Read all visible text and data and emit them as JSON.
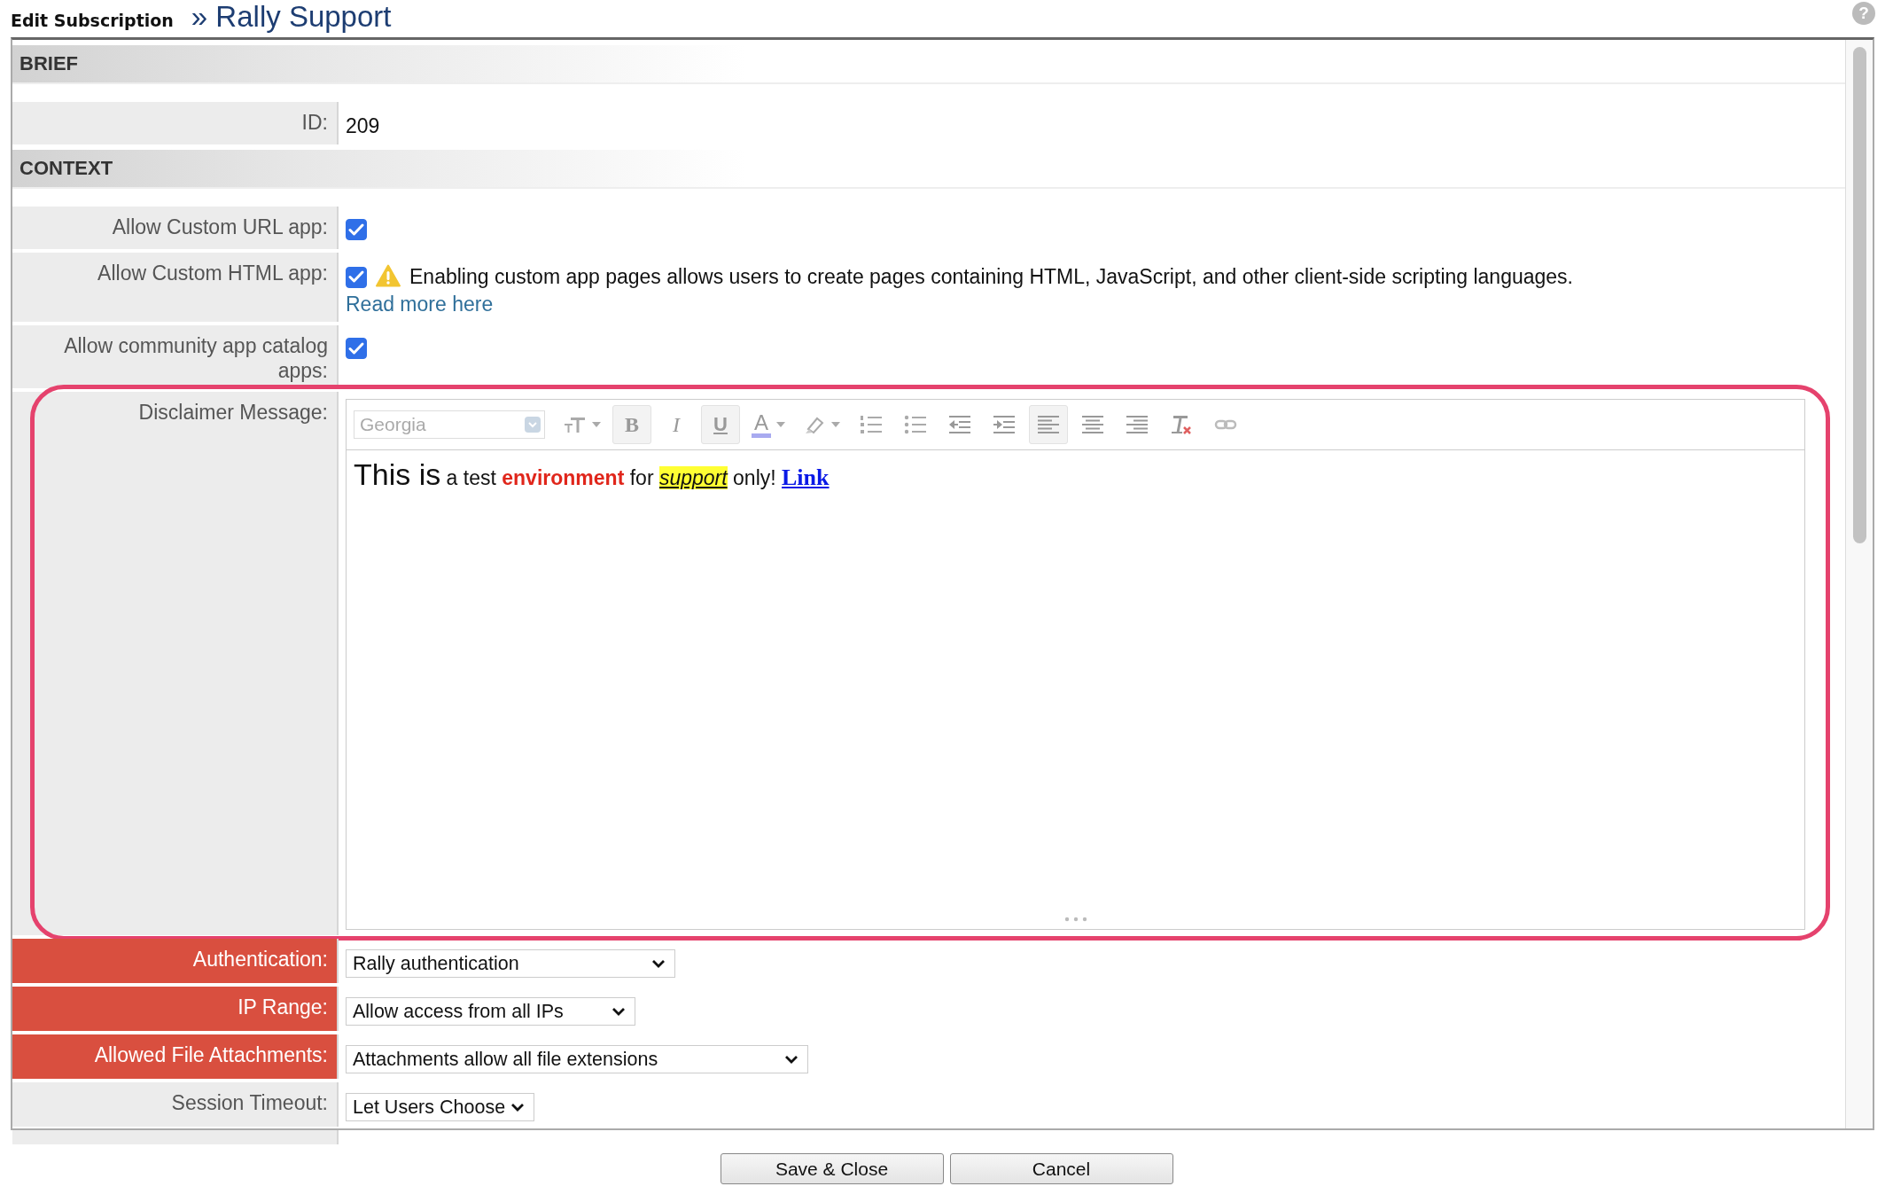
{
  "header": {
    "title": "Edit Subscription",
    "separator": "»",
    "subscription": "Rally Support",
    "help": "?"
  },
  "sections": [
    {
      "title": "BRIEF",
      "rows": [
        {
          "kind": "text",
          "label": "ID:",
          "value": "209",
          "highlighted": false
        }
      ]
    },
    {
      "title": "CONTEXT",
      "rows": [
        {
          "kind": "checkbox",
          "label": "Allow Custom URL app:",
          "checked": true,
          "highlighted": false
        },
        {
          "kind": "checkbox",
          "label": "Allow Custom HTML app:",
          "checked": true,
          "warning": "Enabling custom app pages allows users to create pages containing HTML, JavaScript, and other client-side scripting languages.",
          "link": "Read more here",
          "highlighted": false
        },
        {
          "kind": "checkbox",
          "label": "Allow community app catalog apps:",
          "checked": true,
          "highlighted": false
        },
        {
          "kind": "editor",
          "label": "Disclaimer Message:",
          "highlighted": false,
          "outlined": true,
          "font": {
            "value": "Georgia",
            "disabled": true
          },
          "tools": [
            {
              "kind": "font-size",
              "dropdown": true,
              "selected": false
            },
            {
              "kind": "bold",
              "glyph": "B",
              "dropdown": false,
              "selected": true
            },
            {
              "kind": "italic",
              "glyph": "I",
              "dropdown": false,
              "selected": false
            },
            {
              "kind": "underline",
              "glyph": "U",
              "dropdown": false,
              "selected": true
            },
            {
              "kind": "font-color",
              "glyph": "A",
              "dropdown": true,
              "selected": false
            },
            {
              "kind": "highlight",
              "dropdown": true,
              "selected": false
            },
            {
              "kind": "ordered-list",
              "dropdown": false,
              "selected": false
            },
            {
              "kind": "bulleted-list",
              "dropdown": false,
              "selected": false
            },
            {
              "kind": "outdent",
              "dropdown": false,
              "selected": false
            },
            {
              "kind": "indent",
              "dropdown": false,
              "selected": false
            },
            {
              "kind": "align-left",
              "dropdown": false,
              "selected": true
            },
            {
              "kind": "align-center",
              "dropdown": false,
              "selected": false
            },
            {
              "kind": "align-right",
              "dropdown": false,
              "selected": false
            },
            {
              "kind": "clear-format",
              "dropdown": false,
              "selected": false
            },
            {
              "kind": "link",
              "dropdown": false,
              "selected": false
            }
          ],
          "content": [
            {
              "kind": "large",
              "text": "This is"
            },
            {
              "kind": "plain",
              "text": " a test "
            },
            {
              "kind": "red-bold",
              "text": "environment"
            },
            {
              "kind": "plain",
              "text": " for "
            },
            {
              "kind": "highlight",
              "text": "support"
            },
            {
              "kind": "plain",
              "text": " only! "
            },
            {
              "kind": "link",
              "text": "Link"
            }
          ]
        },
        {
          "kind": "select",
          "label": "Authentication:",
          "value": "Rally authentication",
          "highlighted": true
        },
        {
          "kind": "select",
          "label": "IP Range:",
          "value": "Allow access from all IPs",
          "highlighted": true
        },
        {
          "kind": "select",
          "label": "Allowed File Attachments:",
          "value": "Attachments allow all file extensions",
          "highlighted": true
        },
        {
          "kind": "select",
          "label": "Session Timeout:",
          "value": "Let Users Choose",
          "highlighted": false
        }
      ]
    }
  ],
  "buttons": [
    {
      "label": "Save & Close"
    },
    {
      "label": "Cancel"
    }
  ]
}
